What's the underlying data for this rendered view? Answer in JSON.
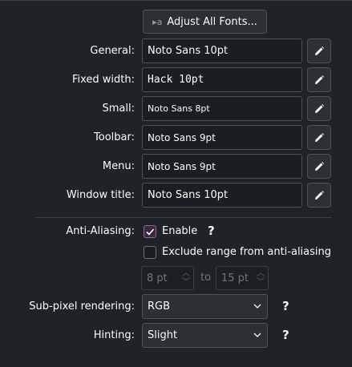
{
  "adjust_button": {
    "label": "Adjust All Fonts...",
    "icon": "font-adjust-icon"
  },
  "fonts": [
    {
      "label": "General:",
      "value": "Noto Sans 10pt"
    },
    {
      "label": "Fixed width:",
      "value": "Hack 10pt"
    },
    {
      "label": "Small:",
      "value": "Noto Sans 8pt"
    },
    {
      "label": "Toolbar:",
      "value": "Noto Sans 9pt"
    },
    {
      "label": "Menu:",
      "value": "Noto Sans 9pt"
    },
    {
      "label": "Window title:",
      "value": "Noto Sans 10pt"
    }
  ],
  "antialiasing": {
    "label": "Anti-Aliasing:",
    "enable_label": "Enable",
    "enable_checked": true,
    "exclude_label": "Exclude range from anti-aliasing",
    "exclude_checked": false,
    "help": "?",
    "range_from": "8 pt",
    "range_to_label": "to",
    "range_to": "15 pt"
  },
  "subpixel": {
    "label": "Sub-pixel rendering:",
    "value": "RGB",
    "help": "?"
  },
  "hinting": {
    "label": "Hinting:",
    "value": "Slight",
    "help": "?"
  },
  "colors": {
    "background": "#202326",
    "text": "#fcfcfc",
    "accent": "#8e6a99",
    "disabled": "#6f757b"
  }
}
